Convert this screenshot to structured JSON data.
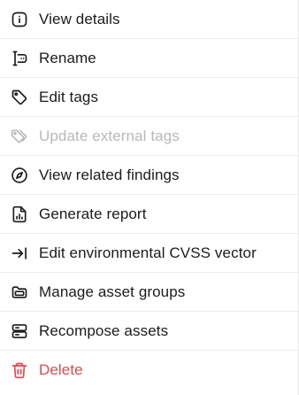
{
  "menu": {
    "items": [
      {
        "label": "View details",
        "icon": "info-square-icon"
      },
      {
        "label": "Rename",
        "icon": "text-cursor-input-icon"
      },
      {
        "label": "Edit tags",
        "icon": "tag-icon"
      },
      {
        "label": "Update external tags",
        "icon": "tags-icon",
        "disabled": true
      },
      {
        "label": "View related findings",
        "icon": "compass-icon"
      },
      {
        "label": "Generate report",
        "icon": "file-chart-icon"
      },
      {
        "label": "Edit environmental CVSS vector",
        "icon": "arrow-right-to-line-icon"
      },
      {
        "label": "Manage asset groups",
        "icon": "folder-icon"
      },
      {
        "label": "Recompose assets",
        "icon": "server-icon"
      },
      {
        "label": "Delete",
        "icon": "trash-icon",
        "danger": true
      }
    ]
  },
  "colors": {
    "text": "#1b1b1f",
    "disabled": "#b8b8bd",
    "danger": "#e5484d",
    "divider": "#ececef"
  }
}
